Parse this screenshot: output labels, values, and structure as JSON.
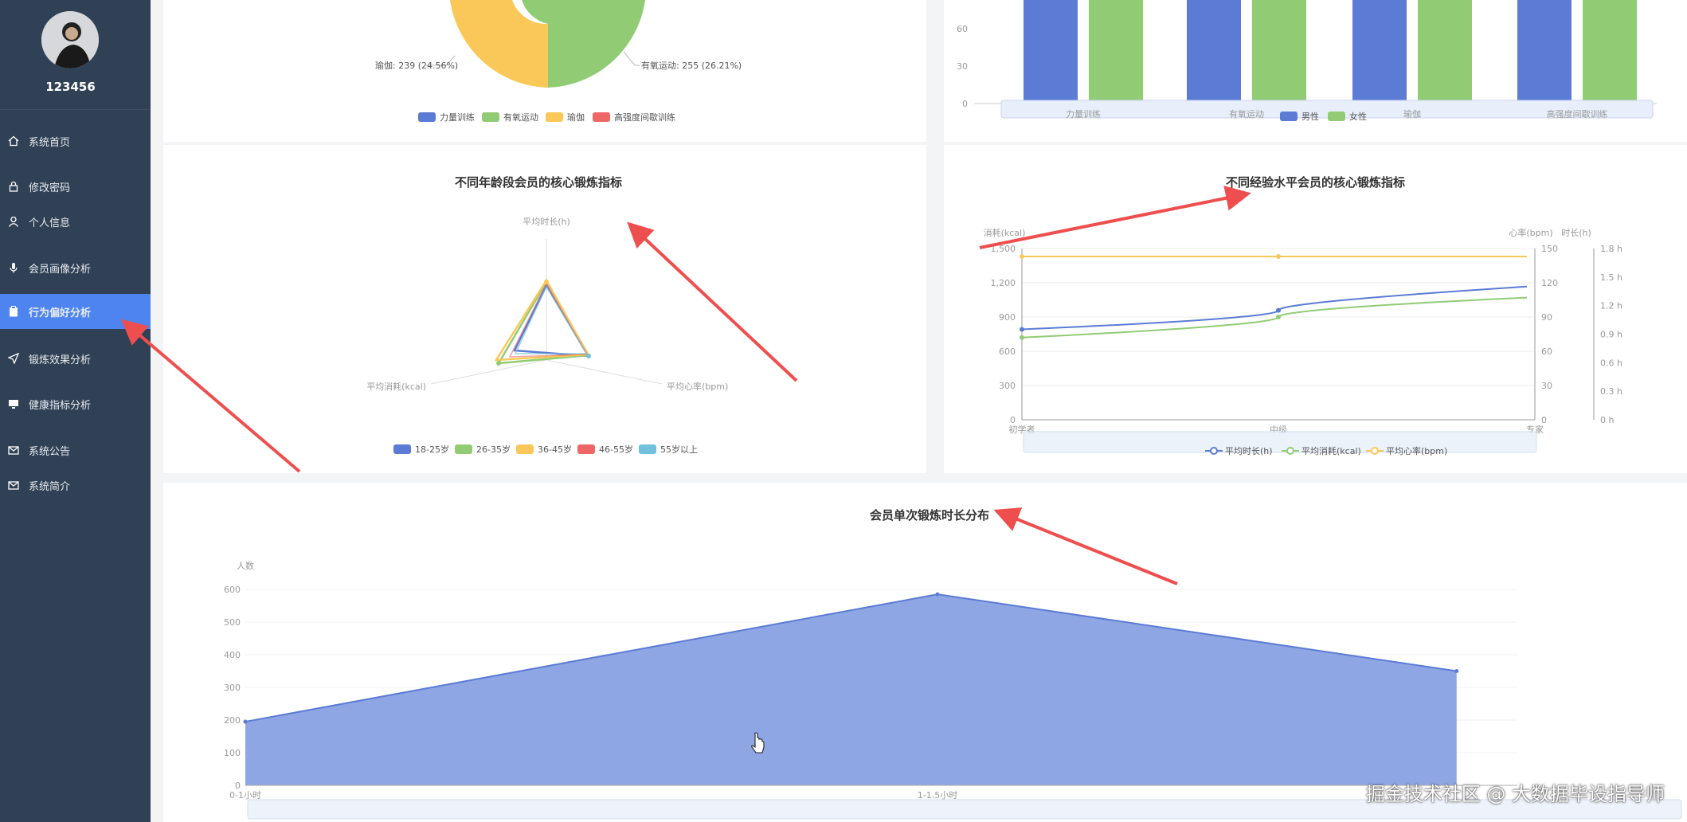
{
  "user": {
    "name": "123456"
  },
  "sidebar": {
    "items": [
      {
        "label": "系统首页",
        "icon": "home-icon"
      },
      {
        "label": "修改密码",
        "icon": "lock-icon"
      },
      {
        "label": "个人信息",
        "icon": "user-icon"
      },
      {
        "label": "会员画像分析",
        "icon": "mic-icon"
      },
      {
        "label": "行为偏好分析",
        "icon": "clipboard-icon",
        "active": true
      },
      {
        "label": "锻炼效果分析",
        "icon": "send-icon"
      },
      {
        "label": "健康指标分析",
        "icon": "monitor-icon"
      },
      {
        "label": "系统公告",
        "icon": "mail-icon"
      },
      {
        "label": "系统简介",
        "icon": "mail-icon"
      }
    ],
    "accent": "#4d84f0",
    "bg": "#304156"
  },
  "colors": {
    "blue": "#5b7bd5",
    "green": "#91cc75",
    "yellow": "#fac858",
    "red": "#ee6666",
    "cyan": "#73c0de"
  },
  "chart_data": [
    {
      "type": "pie",
      "slices": [
        {
          "name": "瑜伽",
          "value": 239,
          "percent": "24.56%"
        },
        {
          "name": "有氧运动",
          "value": 255,
          "percent": "26.21%"
        }
      ],
      "labels": {
        "yoga": "瑜伽: 239 (24.56%)",
        "aerobic": "有氧运动: 255 (26.21%)"
      },
      "legend": [
        "力量训练",
        "有氧运动",
        "瑜伽",
        "高强度间歇训练"
      ]
    },
    {
      "type": "bar",
      "categories": [
        "力量训练",
        "有氧运动",
        "瑜伽",
        "高强度间歇训练"
      ],
      "yticks": [
        "60",
        "30",
        "0"
      ],
      "series": [
        {
          "name": "男性",
          "values": [
            80,
            80,
            80,
            80
          ]
        },
        {
          "name": "女性",
          "values": [
            80,
            80,
            80,
            80
          ]
        }
      ],
      "ylim": [
        0,
        80
      ]
    },
    {
      "type": "radar",
      "title": "不同年龄段会员的核心锻炼指标",
      "indicators": [
        "平均时长(h)",
        "平均心率(bpm)",
        "平均消耗(kcal)"
      ],
      "legend": [
        "18-25岁",
        "26-35岁",
        "36-45岁",
        "46-55岁",
        "55岁以上"
      ]
    },
    {
      "type": "line",
      "title": "不同经验水平会员的核心锻炼指标",
      "categories": [
        "初学者",
        "中级",
        "专家"
      ],
      "yaxis_left": {
        "name": "消耗(kcal)",
        "ticks": [
          "1,500",
          "1,200",
          "900",
          "600",
          "300",
          "0"
        ],
        "ylim": [
          0,
          1500
        ]
      },
      "yaxis_right1": {
        "name": "心率(bpm)",
        "ticks": [
          "150",
          "120",
          "90",
          "60",
          "30",
          "0"
        ],
        "ylim": [
          0,
          150
        ]
      },
      "yaxis_right2": {
        "name": "时长(h)",
        "ticks": [
          "1.8 h",
          "1.5 h",
          "1.2 h",
          "0.9 h",
          "0.6 h",
          "0.3 h",
          "0 h"
        ],
        "ylim": [
          0,
          1.8
        ]
      },
      "series": [
        {
          "name": "平均时长(h)",
          "values": [
            0.95,
            1.15,
            1.4
          ]
        },
        {
          "name": "平均消耗(kcal)",
          "values": [
            720,
            900,
            1070
          ]
        },
        {
          "name": "平均心率(bpm)",
          "values": [
            143,
            143,
            143
          ]
        }
      ]
    },
    {
      "type": "area",
      "title": "会员单次锻炼时长分布",
      "ylabel": "人数",
      "yticks": [
        "600",
        "500",
        "400",
        "300",
        "200",
        "100",
        "0"
      ],
      "ylim": [
        0,
        600
      ],
      "categories": [
        "0-1小时",
        "1-1.5小时"
      ],
      "x_positions": [
        0,
        1,
        1.75
      ],
      "values": [
        195,
        585,
        350
      ]
    }
  ],
  "watermark": "掘金技术社区 @ 大数据毕设指导师"
}
